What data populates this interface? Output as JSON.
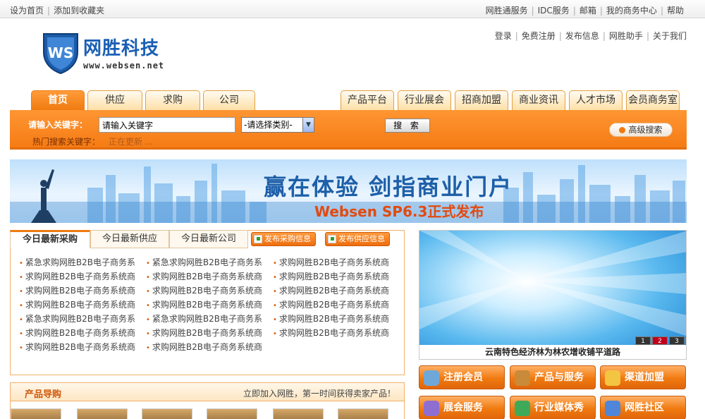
{
  "topbar": {
    "left_links": [
      "设为首页",
      "添加到收藏夹"
    ],
    "right_links": [
      "网胜通服务",
      "IDC服务",
      "邮箱",
      "我的商务中心",
      "帮助"
    ]
  },
  "logo": {
    "mark": "WS",
    "name": "网胜科技",
    "url": "www.websen.net"
  },
  "user_links": [
    "登录",
    "免费注册",
    "发布信息",
    "网胜助手",
    "关于我们"
  ],
  "nav_left": [
    "首页",
    "供应",
    "求购",
    "公司"
  ],
  "nav_right": [
    "产品平台",
    "行业展会",
    "招商加盟",
    "商业资讯",
    "人才市场",
    "会员商务室"
  ],
  "search": {
    "keyword_label": "请输入关键字：",
    "keyword_value": "请输入关键字",
    "category_selected": "-请选择类别-",
    "search_button": "搜 索",
    "hot_label": "热门搜索关键字：",
    "hot_value": "正在更新 ...",
    "advanced_button": "高级搜索"
  },
  "banner": {
    "slogan": "赢在体验 剑指商业门户",
    "subtitle": "Websen SP6.3正式发布"
  },
  "info_tabs": [
    "今日最新采购",
    "今日最新供应",
    "今日最新公司"
  ],
  "publish_buttons": [
    "发布采购信息",
    "发布供应信息"
  ],
  "info_items": [
    [
      "紧急求购网胜B2B电子商务系",
      "求购网胜B2B电子商务系统商",
      "求购网胜B2B电子商务系统商",
      "求购网胜B2B电子商务系统商",
      "紧急求购网胜B2B电子商务系",
      "求购网胜B2B电子商务系统商",
      "求购网胜B2B电子商务系统商"
    ],
    [
      "紧急求购网胜B2B电子商务系",
      "求购网胜B2B电子商务系统商",
      "求购网胜B2B电子商务系统商",
      "求购网胜B2B电子商务系统商",
      "紧急求购网胜B2B电子商务系",
      "求购网胜B2B电子商务系统商",
      "求购网胜B2B电子商务系统商"
    ],
    [
      "求购网胜B2B电子商务系统商",
      "求购网胜B2B电子商务系统商",
      "求购网胜B2B电子商务系统商",
      "求购网胜B2B电子商务系统商",
      "求购网胜B2B电子商务系统商",
      "求购网胜B2B电子商务系统商"
    ]
  ],
  "product_guide": {
    "title": "产品导购",
    "slogan": "立即加入网胜，第一时间获得卖家产品！"
  },
  "slideshow": {
    "caption": "云南特色经济林为林农增收铺平道路",
    "pages": [
      "1",
      "2",
      "3"
    ],
    "active_page": 2
  },
  "services": [
    {
      "label": "注册会员",
      "icon": "users-icon",
      "color": "#6fa8d8"
    },
    {
      "label": "产品与服务",
      "icon": "coffee-cup-icon",
      "color": "#c98a3a"
    },
    {
      "label": "渠道加盟",
      "icon": "document-icon",
      "color": "#f4c542"
    },
    {
      "label": "展会服务",
      "icon": "gear-icon",
      "color": "#8e6fd1"
    },
    {
      "label": "行业媒体秀",
      "icon": "book-icon",
      "color": "#3fa95a"
    },
    {
      "label": "网胜社区",
      "icon": "building-icon",
      "color": "#4f86d9"
    }
  ]
}
